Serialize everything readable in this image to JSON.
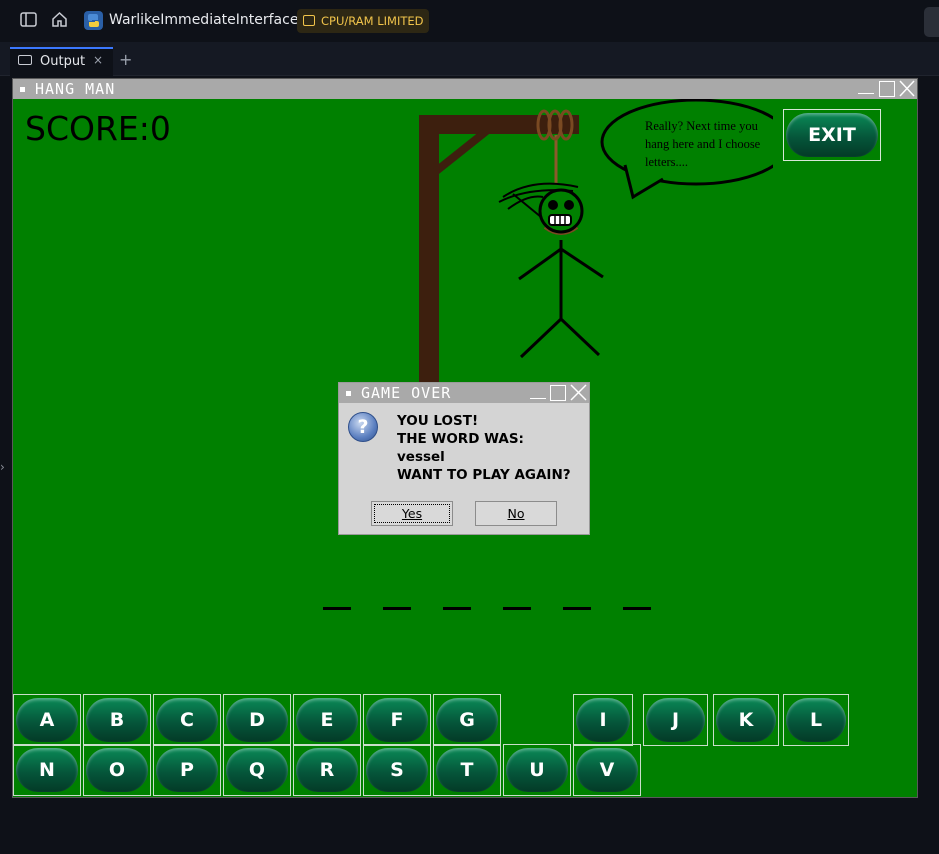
{
  "topbar": {
    "app_name": "WarlikeImmediateInterfaces",
    "badge": "CPU/RAM LIMITED",
    "sidebar_icon": "sidebar-toggle-icon",
    "home_icon": "home-icon",
    "python_icon": "python-icon"
  },
  "tabs": {
    "output_label": "Output",
    "close_glyph": "×",
    "add_glyph": "+"
  },
  "window": {
    "title": "HANG MAN",
    "score": "SCORE:0",
    "exit_label": "EXIT",
    "speech": [
      "Really? Next time you",
      "hang here and I choose",
      "letters...."
    ],
    "word_blanks": 6
  },
  "keys_row1": [
    "A",
    "B",
    "C",
    "D",
    "E",
    "F",
    "G",
    "I",
    "J",
    "K",
    "L"
  ],
  "keys_row2": [
    "N",
    "O",
    "P",
    "Q",
    "R",
    "S",
    "T",
    "U",
    "V"
  ],
  "dialog": {
    "title": "GAME OVER",
    "lines": [
      "YOU LOST!",
      "THE WORD WAS:",
      "vessel",
      "WANT TO PLAY AGAIN?"
    ],
    "yes_label": "Yes",
    "no_label": "No",
    "icon": "question-icon"
  },
  "colors": {
    "background_green": "#008000",
    "gallows_brown": "#3d1f0e",
    "button_green": "#05563a"
  }
}
